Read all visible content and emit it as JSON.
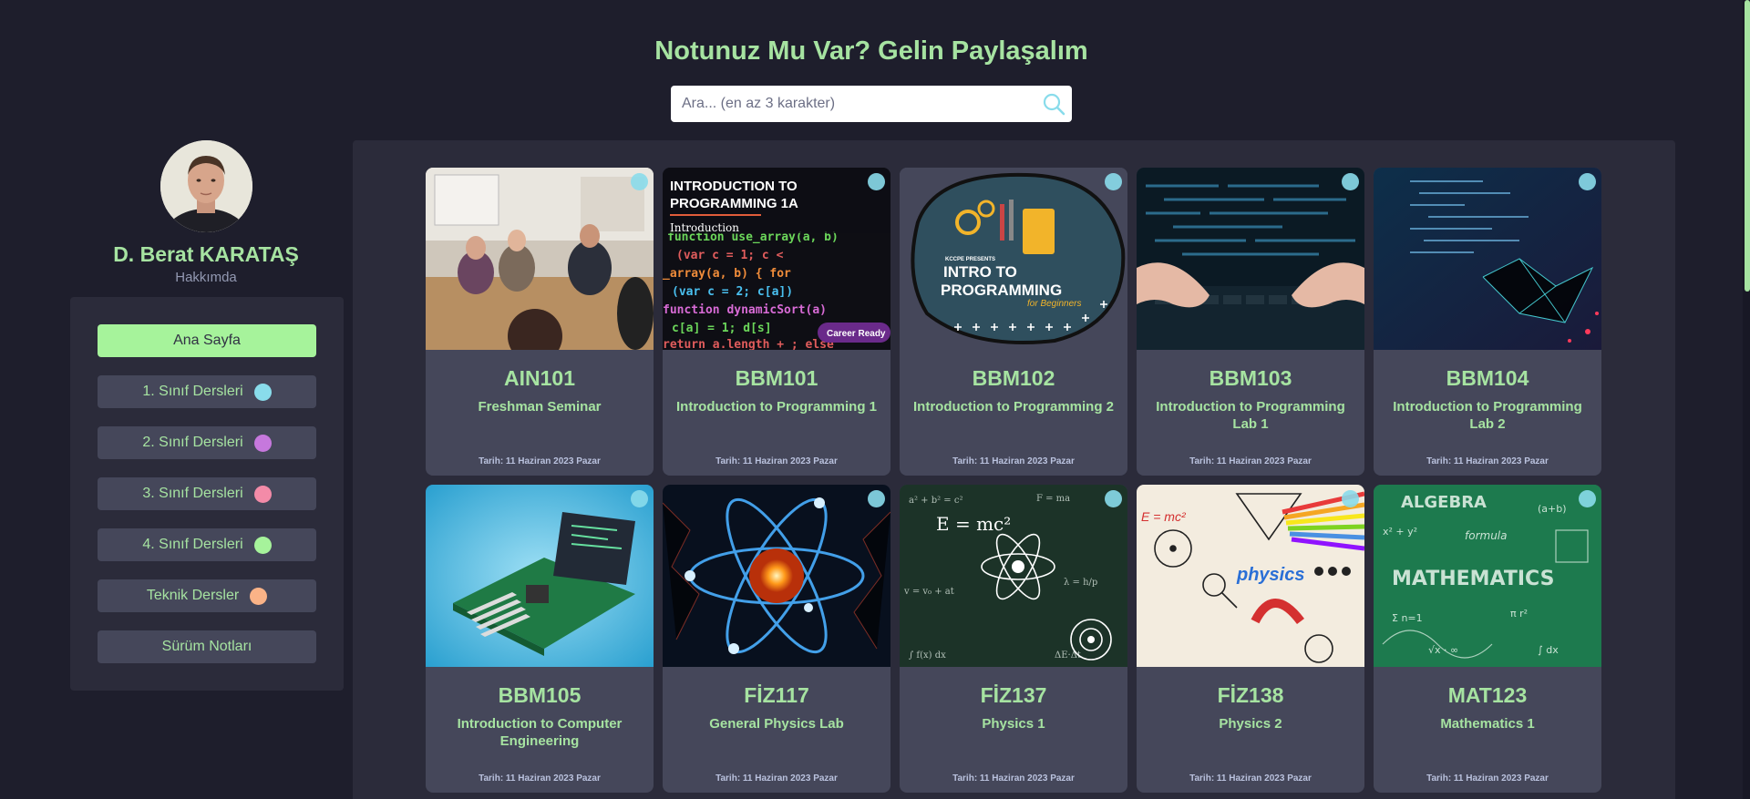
{
  "header": {
    "title": "Notunuz Mu Var? Gelin Paylaşalım",
    "search_placeholder": "Ara... (en az 3 karakter)"
  },
  "profile": {
    "name": "D. Berat KARATAŞ",
    "about": "Hakkımda"
  },
  "sidebar": {
    "items": [
      {
        "label": "Ana Sayfa",
        "active": true
      },
      {
        "label": "1. Sınıf Dersleri",
        "dot_color": "#89dceb"
      },
      {
        "label": "2. Sınıf Dersleri",
        "dot_color": "#c678dd"
      },
      {
        "label": "3. Sınıf Dersleri",
        "dot_color": "#f38ba8"
      },
      {
        "label": "4. Sınıf Dersleri",
        "dot_color": "#a6f39b"
      },
      {
        "label": "Teknik Dersler",
        "dot_color": "#fab387"
      },
      {
        "label": "Sürüm Notları"
      }
    ]
  },
  "courses": [
    {
      "code": "AIN101",
      "name": "Freshman Seminar",
      "date": "Tarih: 11 Haziran 2023 Pazar",
      "image": "meeting-photo"
    },
    {
      "code": "BBM101",
      "name": "Introduction to Programming 1",
      "date": "Tarih: 11 Haziran 2023 Pazar",
      "image": "code-screen-photo",
      "image_text": [
        "INTRODUCTION TO",
        "PROGRAMMING 1A",
        "Introduction",
        "Career Ready"
      ]
    },
    {
      "code": "BBM102",
      "name": "Introduction to Programming 2",
      "date": "Tarih: 11 Haziran 2023 Pazar",
      "image": "programming-illustration",
      "image_text": [
        "KCCPE PRESENTS",
        "INTRO TO",
        "PROGRAMMING",
        "for Beginners"
      ]
    },
    {
      "code": "BBM103",
      "name": "Introduction to Programming Lab 1",
      "date": "Tarih: 11 Haziran 2023 Pazar",
      "image": "hands-code-photo"
    },
    {
      "code": "BBM104",
      "name": "Introduction to Programming Lab 2",
      "date": "Tarih: 11 Haziran 2023 Pazar",
      "image": "code-network-photo"
    },
    {
      "code": "BBM105",
      "name": "Introduction to Computer Engineering",
      "date": "Tarih: 11 Haziran 2023 Pazar",
      "image": "circuit-board-illustration"
    },
    {
      "code": "FİZ117",
      "name": "General Physics Lab",
      "date": "Tarih: 11 Haziran 2023 Pazar",
      "image": "atom-illustration"
    },
    {
      "code": "FİZ137",
      "name": "Physics 1",
      "date": "Tarih: 11 Haziran 2023 Pazar",
      "image": "chalkboard-physics",
      "image_text": [
        "E = mc²"
      ]
    },
    {
      "code": "FİZ138",
      "name": "Physics 2",
      "date": "Tarih: 11 Haziran 2023 Pazar",
      "image": "physics-doodles",
      "image_text": [
        "physics",
        "E = mc²"
      ]
    },
    {
      "code": "MAT123",
      "name": "Mathematics 1",
      "date": "Tarih: 11 Haziran 2023 Pazar",
      "image": "math-chalkboard",
      "image_text": [
        "ALGEBRA",
        "MATHEMATICS",
        "formula"
      ]
    }
  ],
  "colors": {
    "background": "#1e1e2c",
    "panel": "#2b2b3a",
    "card": "#45475a",
    "accent_green": "#a6e3a1",
    "card_dot": "#89dceb"
  },
  "icons": {
    "search": "search-icon"
  }
}
